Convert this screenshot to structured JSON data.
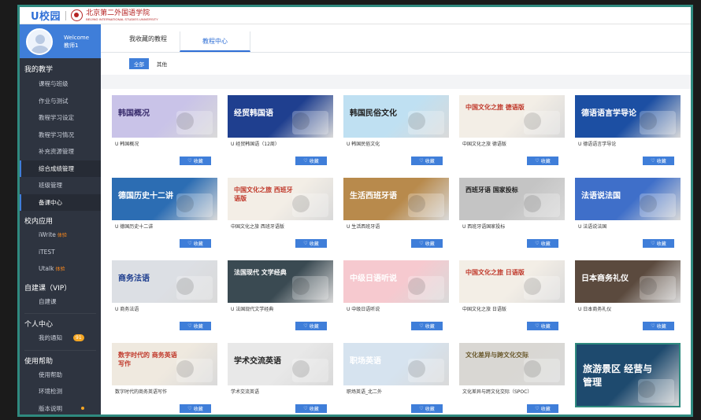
{
  "header": {
    "logo": "U校园",
    "school_name": "北京第二外国语学院",
    "school_sub": "BEIJING INTERNATIONAL STUDIES UNIVERSITY"
  },
  "user": {
    "welcome": "Welcome",
    "name": "教师1"
  },
  "sidebar": {
    "groups": [
      {
        "title": "我的教学",
        "items": [
          "课程与班级",
          "作业与测试",
          "教程学习设定",
          "教程学习情况",
          "补充资源管理",
          "综合成绩管理",
          "班级管理",
          "备课中心"
        ]
      },
      {
        "title": "校内应用",
        "items": [
          "iWrite",
          "iTEST",
          "Utalk"
        ],
        "tags": [
          "体验",
          "",
          "体验"
        ]
      },
      {
        "title": "自建课（VIP）",
        "items": [
          "自建课"
        ]
      },
      {
        "title": "个人中心",
        "items": [
          "我的通知"
        ],
        "badge": "91"
      },
      {
        "title": "使用帮助",
        "items": [
          "使用帮助",
          "环境检测",
          "版本说明"
        ]
      }
    ]
  },
  "tabs": [
    "我收藏的教程",
    "教程中心"
  ],
  "filters": [
    "全部",
    "其他"
  ],
  "fav_label": "收藏",
  "courses": [
    {
      "name": "U 韩国概况",
      "thumb": "韩国概况",
      "bg": "#c9c3e8",
      "fg": "#3a2e6e"
    },
    {
      "name": "U 经贸韩国语（12周）",
      "thumb": "经贸韩国语",
      "bg": "#1f3f8f",
      "fg": "#ffffff"
    },
    {
      "name": "U 韩国民俗文化",
      "thumb": "韩国民俗文化",
      "bg": "#bfe0f2",
      "fg": "#222222"
    },
    {
      "name": "中国文化之旅 德语版",
      "thumb": "中国文化之旅 德语版",
      "bg": "#f3eee6",
      "fg": "#c0392b"
    },
    {
      "name": "U 德语语言学导论",
      "thumb": "德语语言学导论",
      "bg": "#1c4fa3",
      "fg": "#ffffff"
    },
    {
      "name": "U 德国历史十二讲",
      "thumb": "德国历史十二讲",
      "bg": "#2c6db3",
      "fg": "#ffffff"
    },
    {
      "name": "中国文化之旅 西班牙语版",
      "thumb": "中国文化之旅 西班牙语版",
      "bg": "#f3eee6",
      "fg": "#c0392b"
    },
    {
      "name": "U 生活西班牙语",
      "thumb": "生活西班牙语",
      "bg": "#b88a4c",
      "fg": "#ffffff"
    },
    {
      "name": "U 西班牙语国家投标",
      "thumb": "西班牙语 国家投标",
      "bg": "#c4c4c4",
      "fg": "#222222"
    },
    {
      "name": "U 法语说法国",
      "thumb": "法语说法国",
      "bg": "#3f6fc9",
      "fg": "#ffffff"
    },
    {
      "name": "U 商务法语",
      "thumb": "商务法语",
      "bg": "#dcdfe4",
      "fg": "#1f3f8f"
    },
    {
      "name": "U 法国现代文学经典",
      "thumb": "法国现代 文学经典",
      "bg": "#3a4a52",
      "fg": "#ffffff"
    },
    {
      "name": "U 中级日语听说",
      "thumb": "中级日语听说",
      "bg": "#f6c9cf",
      "fg": "#ffffff"
    },
    {
      "name": "中国文化之旅 日语版",
      "thumb": "中国文化之旅 日语版",
      "bg": "#f3eee6",
      "fg": "#c0392b"
    },
    {
      "name": "U 日本商务礼仪",
      "thumb": "日本商务礼仪",
      "bg": "#5b4a3e",
      "fg": "#ffffff"
    },
    {
      "name": "数字时代的商务英语写作",
      "thumb": "数字时代的 商务英语写作",
      "bg": "#efe9df",
      "fg": "#c0392b"
    },
    {
      "name": "学术交流英语",
      "thumb": "学术交流英语",
      "bg": "#e8e8e8",
      "fg": "#222222"
    },
    {
      "name": "职场英语_北二外",
      "thumb": "职场英语",
      "bg": "#d6e3ef",
      "fg": "#ffffff"
    },
    {
      "name": "文化差异与跨文化交际（SPOC）",
      "thumb": "文化差异与跨文化交际",
      "bg": "#d9d7d3",
      "fg": "#6b5a2e"
    },
    {
      "name": "",
      "thumb": "旅游景区 经营与管理",
      "bg": "#1e4a6e",
      "fg": "#ffffff"
    }
  ]
}
